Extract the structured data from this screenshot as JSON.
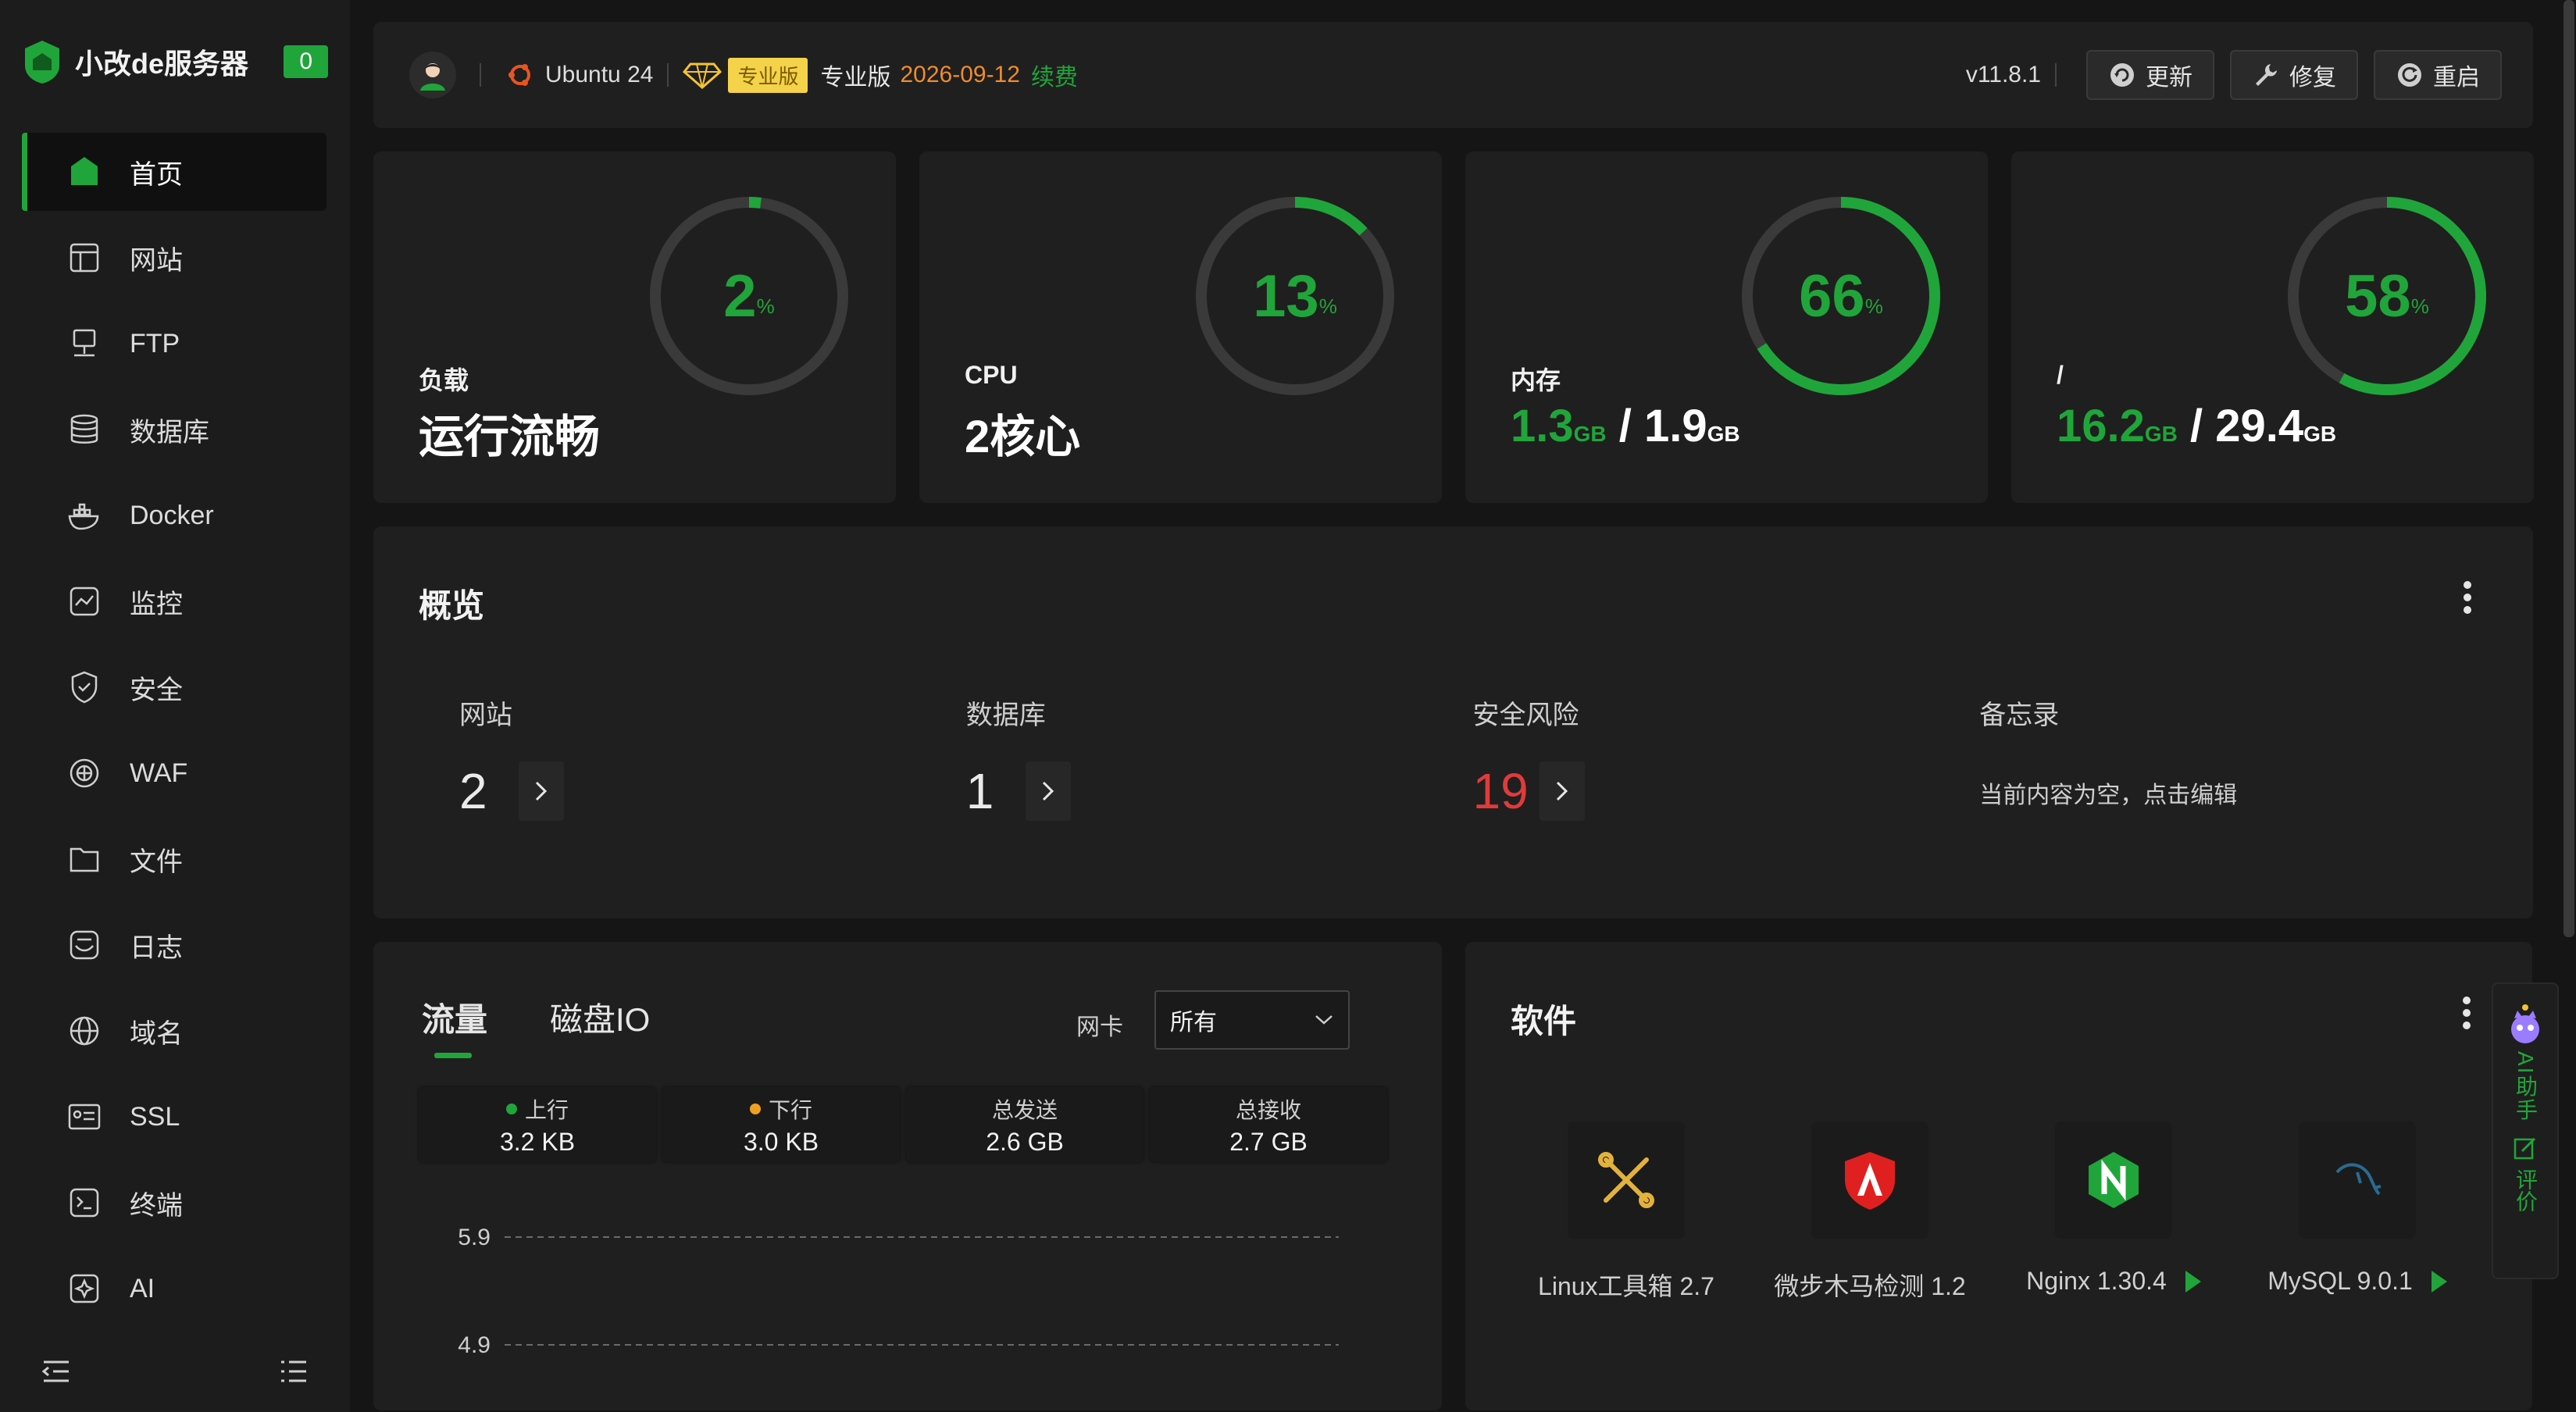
{
  "brand": {
    "name": "小改de服务器",
    "badge": "0"
  },
  "nav": [
    {
      "label": "首页",
      "icon": "home-icon"
    },
    {
      "label": "网站",
      "icon": "website-icon"
    },
    {
      "label": "FTP",
      "icon": "ftp-icon"
    },
    {
      "label": "数据库",
      "icon": "database-icon"
    },
    {
      "label": "Docker",
      "icon": "docker-icon"
    },
    {
      "label": "监控",
      "icon": "monitor-icon"
    },
    {
      "label": "安全",
      "icon": "shield-icon"
    },
    {
      "label": "WAF",
      "icon": "waf-icon"
    },
    {
      "label": "文件",
      "icon": "folder-icon"
    },
    {
      "label": "日志",
      "icon": "log-icon"
    },
    {
      "label": "域名",
      "icon": "globe-icon"
    },
    {
      "label": "SSL",
      "icon": "ssl-icon"
    },
    {
      "label": "终端",
      "icon": "terminal-icon"
    },
    {
      "label": "AI",
      "icon": "ai-icon"
    }
  ],
  "topbar": {
    "os": "Ubuntu 24",
    "pro_badge": "专业版",
    "pro_text": "专业版",
    "expire": "2026-09-12",
    "renew": "续费",
    "version": "v11.8.1",
    "buttons": {
      "update": "更新",
      "repair": "修复",
      "restart": "重启"
    }
  },
  "stats": [
    {
      "percent": 2,
      "display": "2",
      "unit": "%",
      "label": "负载",
      "value": "运行流畅"
    },
    {
      "percent": 13,
      "display": "13",
      "unit": "%",
      "label": "CPU",
      "value": "2核心"
    },
    {
      "percent": 66,
      "display": "66",
      "unit": "%",
      "label": "内存",
      "used": "1.3",
      "total": "1.9",
      "size_unit": "GB"
    },
    {
      "percent": 58,
      "display": "58",
      "unit": "%",
      "label": "/",
      "used": "16.2",
      "total": "29.4",
      "size_unit": "GB"
    }
  ],
  "overview": {
    "title": "概览",
    "items": [
      {
        "label": "网站",
        "value": "2"
      },
      {
        "label": "数据库",
        "value": "1"
      },
      {
        "label": "安全风险",
        "value": "19"
      },
      {
        "label": "备忘录",
        "text": "当前内容为空，点击编辑"
      }
    ]
  },
  "traffic": {
    "tabs": [
      "流量",
      "磁盘IO"
    ],
    "nic_label": "网卡",
    "nic_selected": "所有",
    "metrics": [
      {
        "label": "上行",
        "value": "3.2 KB",
        "dot": "#20a53a"
      },
      {
        "label": "下行",
        "value": "3.0 KB",
        "dot": "#f0a020"
      },
      {
        "label": "总发送",
        "value": "2.6 GB"
      },
      {
        "label": "总接收",
        "value": "2.7 GB"
      }
    ],
    "chart_data": {
      "type": "line",
      "y_ticks": [
        "5.9",
        "4.9"
      ],
      "series": []
    }
  },
  "software": {
    "title": "软件",
    "items": [
      {
        "name": "Linux工具箱 2.7",
        "icon": "toolbox-icon",
        "playable": false
      },
      {
        "name": "微步木马检测 1.2",
        "icon": "trojan-detect-icon",
        "playable": false
      },
      {
        "name": "Nginx 1.30.4",
        "icon": "nginx-icon",
        "playable": true
      },
      {
        "name": "MySQL 9.0.1",
        "icon": "mysql-icon",
        "playable": true
      }
    ]
  },
  "ai_float": {
    "assistant": "AI助手",
    "rate": "评价"
  },
  "colors": {
    "accent": "#20a53a",
    "danger": "#e23a3a",
    "warn": "#f08c2c"
  }
}
